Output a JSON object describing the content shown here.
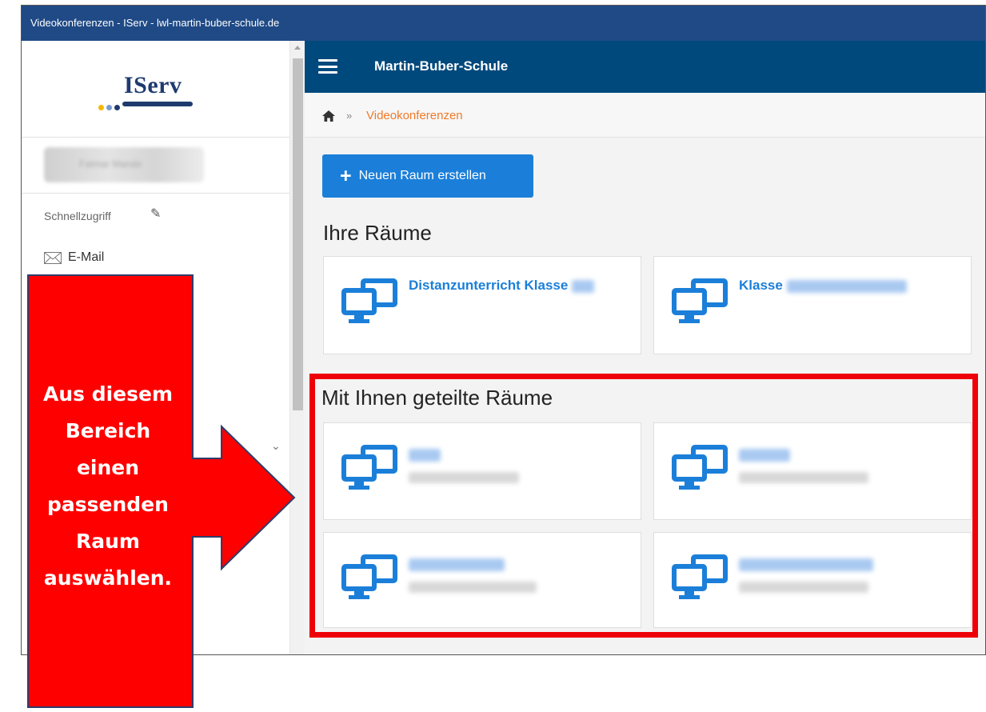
{
  "window": {
    "title": "Videokonferenzen - IServ - lwl-martin-buber-schule.de"
  },
  "sidebar": {
    "logo_text": "IServ",
    "logo_dot_colors": [
      "#f6b700",
      "#7a9ccf",
      "#1f3b6e"
    ],
    "user_name": "Fatmar Mande",
    "quick_access_label": "Schnellzugriff",
    "mail_label": "E-Mail"
  },
  "header": {
    "school_name": "Martin-Buber-Schule"
  },
  "breadcrumb": {
    "separator": "»",
    "current": "Videokonferenzen"
  },
  "actions": {
    "new_room_label": "Neuen Raum erstellen"
  },
  "own_rooms": {
    "heading": "Ihre Räume",
    "rooms": [
      {
        "title": "Distanzunterricht Klasse"
      },
      {
        "title": "Klasse"
      }
    ]
  },
  "shared_rooms": {
    "heading": "Mit Ihnen geteilte Räume"
  },
  "callout": {
    "lines": [
      "Aus diesem",
      "Bereich",
      "einen",
      "passenden",
      "Raum",
      "auswählen."
    ],
    "color": "#ff0000"
  },
  "colors": {
    "titlebar": "#1f4a86",
    "header": "#00497d",
    "accent_blue": "#1b7fd9",
    "breadcrumb_orange": "#f07a28",
    "highlight_red": "#ee0008"
  }
}
